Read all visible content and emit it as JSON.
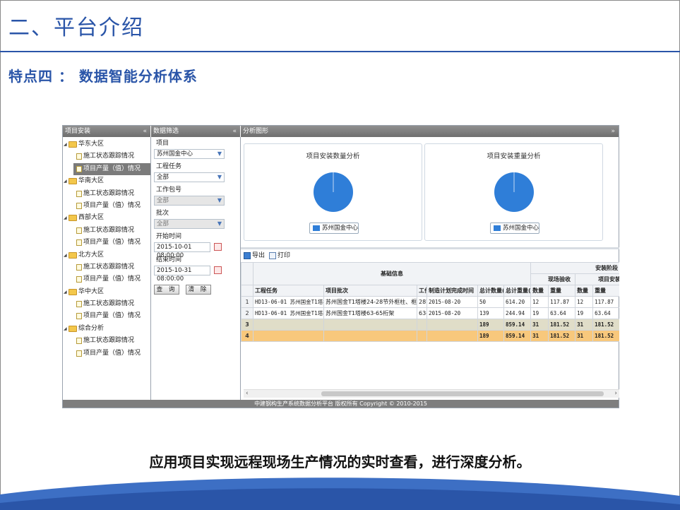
{
  "slide": {
    "title": "二、平台介绍",
    "subtitle": "特点四 ： 数据智能分析体系",
    "caption": "应用项目实现远程现场生产情况的实时查看，进行深度分析。"
  },
  "colors": {
    "accent": "#2a55a8",
    "pie": "#2f7ed8",
    "header_bar": "#7b7b7b",
    "sum_row_1": "#e0ddc8",
    "sum_row_2": "#f8c87c"
  },
  "panels": {
    "tree_title": "项目安装",
    "filter_title": "数据筛选",
    "charts_title": "分析图形",
    "collapse_symbol": "«",
    "expand_symbol": "»"
  },
  "tree": {
    "groups": [
      {
        "label": "华东大区",
        "items": [
          "施工状态跟踪情况",
          "项目产量（值）情况"
        ]
      },
      {
        "label": "华南大区",
        "items": [
          "施工状态跟踪情况",
          "项目产量（值）情况"
        ]
      },
      {
        "label": "西部大区",
        "items": [
          "施工状态跟踪情况",
          "项目产量（值）情况"
        ]
      },
      {
        "label": "北方大区",
        "items": [
          "施工状态跟踪情况",
          "项目产量（值）情况"
        ]
      },
      {
        "label": "华中大区",
        "items": [
          "施工状态跟踪情况",
          "项目产量（值）情况"
        ]
      },
      {
        "label": "综合分析",
        "items": [
          "施工状态跟踪情况",
          "项目产量（值）情况"
        ]
      }
    ],
    "selected": "项目产量（值）情况"
  },
  "filter": {
    "project_label": "项目",
    "project_value": "苏州国金中心",
    "task_label": "工程任务",
    "task_value": "全部",
    "package_label": "工作包号",
    "package_value": "全部",
    "batch_label": "批次",
    "batch_value": "全部",
    "start_label": "开始时间",
    "start_value": "2015-10-01 08:00:00",
    "end_label": "结束时间",
    "end_value": "2015-10-31 08:00:00",
    "query_button": "查 询",
    "clear_button": "清 除"
  },
  "charts": {
    "quantity_title": "项目安装数量分析",
    "weight_title": "项目安装重量分析",
    "legend_label": "苏州国金中心"
  },
  "toolbar": {
    "export_label": "导出",
    "print_label": "打印"
  },
  "grid": {
    "group_basic": "基础信息",
    "group_stage": "安装阶段",
    "group_site": "现场验收",
    "group_install": "项目安装",
    "columns": [
      "工程任务",
      "项目批次",
      "工作",
      "制造计划完成时间",
      "总计数量(",
      "总计重量(",
      "数量",
      "重量",
      "数量",
      "重量"
    ],
    "rows": [
      [
        "1",
        "HD13-06-01 苏州国金T1塔楼",
        "苏州国金T1塔楼24-28节外框柱、框梁",
        "28节",
        "2015-08-20",
        "50",
        "614.20",
        "12",
        "117.87",
        "12",
        "117.87"
      ],
      [
        "2",
        "HD13-06-01 苏州国金T1塔楼",
        "苏州国金T1塔楼63-65桁架",
        "63-6",
        "2015-08-20",
        "139",
        "244.94",
        "19",
        "63.64",
        "19",
        "63.64"
      ]
    ],
    "summary_rows": [
      [
        "3",
        "",
        "",
        "",
        "",
        "189",
        "859.14",
        "31",
        "181.52",
        "31",
        "181.52"
      ],
      [
        "4",
        "",
        "",
        "",
        "",
        "189",
        "859.14",
        "31",
        "181.52",
        "31",
        "181.52"
      ]
    ]
  },
  "footer": {
    "text": "中建钢构生产系统数据分析平台 版权所有 Copyright © 2010-2015"
  },
  "scroll": {
    "left_arrow": "‹",
    "right_arrow": "›"
  }
}
